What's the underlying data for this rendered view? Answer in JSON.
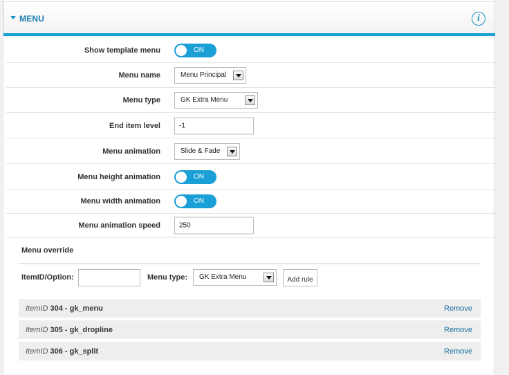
{
  "header": {
    "title": "MENU",
    "info_icon": "info-icon"
  },
  "fields": {
    "show_template_menu": {
      "label": "Show template menu",
      "state": "ON"
    },
    "menu_name": {
      "label": "Menu name",
      "value": "Menu Principal"
    },
    "menu_type": {
      "label": "Menu type",
      "value": "GK Extra Menu"
    },
    "end_item_level": {
      "label": "End item level",
      "value": "-1"
    },
    "menu_animation": {
      "label": "Menu animation",
      "value": "Slide & Fade"
    },
    "menu_height_animation": {
      "label": "Menu height animation",
      "state": "ON"
    },
    "menu_width_animation": {
      "label": "Menu width animation",
      "state": "ON"
    },
    "menu_animation_speed": {
      "label": "Menu animation speed",
      "value": "250"
    }
  },
  "override": {
    "title": "Menu override",
    "itemid_label": "ItemID/Option:",
    "itemid_value": "",
    "type_label": "Menu type:",
    "type_value": "GK Extra Menu",
    "add_rule": "Add rule",
    "rules": [
      {
        "prefix": "ItemID",
        "text": "304 - gk_menu",
        "action": "Remove"
      },
      {
        "prefix": "ItemID",
        "text": "305 - gk_dropline",
        "action": "Remove"
      },
      {
        "prefix": "ItemID",
        "text": "306 - gk_split",
        "action": "Remove"
      }
    ]
  },
  "colors": {
    "accent": "#1a9fd6",
    "link": "#1a6fa0",
    "row_bg": "#eeeeee"
  }
}
